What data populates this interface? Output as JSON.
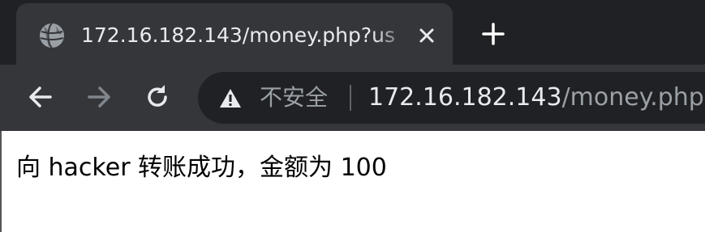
{
  "tab": {
    "title": "172.16.182.143/money.php?us",
    "favicon": "globe-icon",
    "close": "close-icon"
  },
  "new_tab": "plus-icon",
  "toolbar": {
    "back": "back-arrow-icon",
    "forward": "forward-arrow-icon",
    "reload": "reload-icon"
  },
  "omnibox": {
    "security_icon": "warning-triangle-icon",
    "security_label": "不安全",
    "url_host": "172.16.182.143",
    "url_path": "/money.php?"
  },
  "page": {
    "message": "向 hacker 转账成功，金额为 100"
  },
  "colors": {
    "tab_strip_bg": "#202124",
    "active_tab_bg": "#35363a",
    "omnibox_bg": "#202124",
    "text_primary": "#e8eaed",
    "text_secondary": "#9aa0a6"
  }
}
